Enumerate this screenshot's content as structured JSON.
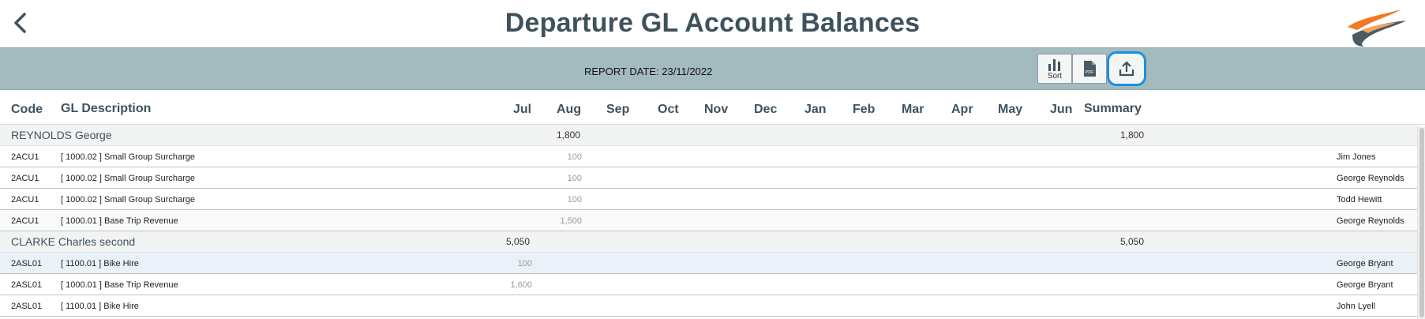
{
  "header": {
    "title": "Departure GL Account Balances"
  },
  "toolbar": {
    "report_date": "REPORT DATE: 23/11/2022",
    "sort_label": "Sort",
    "pdf_label": "PDF"
  },
  "columns": [
    "Code",
    "GL Description",
    "Jul",
    "Aug",
    "Sep",
    "Oct",
    "Nov",
    "Dec",
    "Jan",
    "Feb",
    "Mar",
    "Apr",
    "May",
    "Jun",
    "Summary"
  ],
  "groups": [
    {
      "name": "REYNOLDS George",
      "aug": "1,800",
      "summary": "1,800",
      "rows": [
        {
          "code": "2ACU1",
          "desc": "[ 1000.02 ]  Small Group Surcharge",
          "aug": "100",
          "person": "Jim Jones"
        },
        {
          "code": "2ACU1",
          "desc": "[ 1000.02 ]  Small Group Surcharge",
          "aug": "100",
          "person": "George Reynolds"
        },
        {
          "code": "2ACU1",
          "desc": "[ 1000.02 ]  Small Group Surcharge",
          "aug": "100",
          "person": "Todd Hewitt"
        },
        {
          "code": "2ACU1",
          "desc": "[ 1000.01 ]  Base Trip Revenue",
          "aug": "1,500",
          "person": "George Reynolds"
        }
      ]
    },
    {
      "name": "CLARKE Charles second",
      "jul": "5,050",
      "summary": "5,050",
      "rows": [
        {
          "code": "2ASL01",
          "desc": "[ 1100.01 ]  Bike Hire",
          "jul": "100",
          "person": "George Bryant"
        },
        {
          "code": "2ASL01",
          "desc": "[ 1000.01 ]  Base Trip Revenue",
          "jul": "1,600",
          "person": "George Bryant"
        },
        {
          "code": "2ASL01",
          "desc": "[ 1100.01 ]  Bike Hire",
          "person": "John Lyell"
        }
      ]
    }
  ]
}
